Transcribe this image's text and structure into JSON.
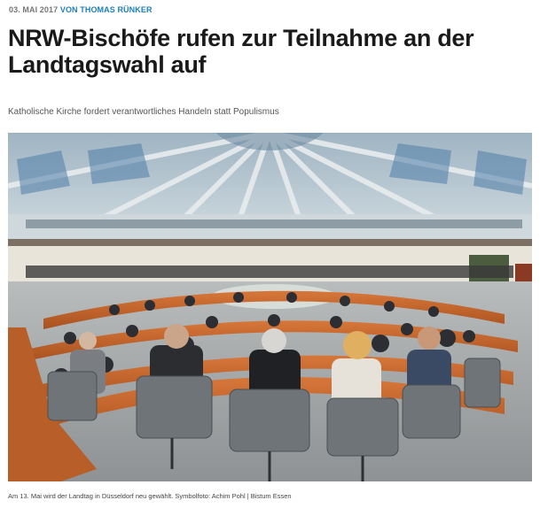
{
  "article": {
    "date": "03. MAI 2017",
    "author": "VON THOMAS RÜNKER",
    "headline": "NRW-Bischöfe rufen zur Teilnahme an der Landtagswahl auf",
    "subtitle": "Katholische Kirche fordert verantwortliches Handeln statt Populismus",
    "caption": "Am 13. Mai wird der Landtag in Düsseldorf neu gewählt. Symbolfoto: Achim Pohl | Bistum Essen"
  },
  "colors": {
    "author_link": "#1e7fb8",
    "headline": "#1a1a1a",
    "desk_wood": "#c8662c",
    "chair_grey": "#6f7478"
  }
}
